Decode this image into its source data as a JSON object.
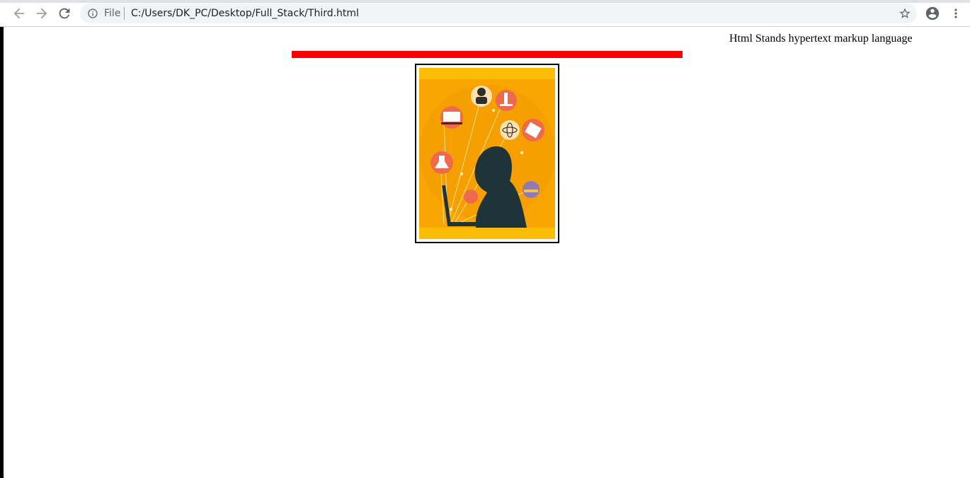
{
  "browser": {
    "address_scheme_label": "File",
    "url": "C:/Users/DK_PC/Desktop/Full_Stack/Third.html",
    "icons": [
      "back-arrow-icon",
      "forward-arrow-icon",
      "reload-icon",
      "info-icon",
      "star-icon",
      "account-icon",
      "more-vert-icon"
    ]
  },
  "page": {
    "marquee_text": "Html Stands hypertext markup language",
    "divider_color": "#ff0000",
    "image_alt": "student studying illustration"
  }
}
